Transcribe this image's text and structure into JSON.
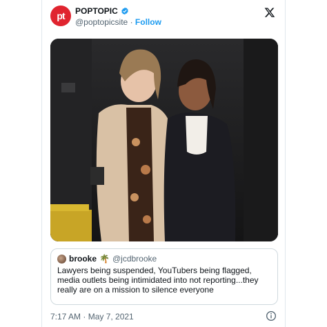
{
  "account": {
    "avatar_text": "pt",
    "name": "POPTOPIC",
    "handle": "@poptopicsite",
    "separator": "·",
    "follow_label": "Follow",
    "brand_color": "#e0242f",
    "accent_color": "#1d9bf0"
  },
  "icons": {
    "verified": "verified-badge-icon",
    "platform": "x-logo-icon",
    "info": "info-icon"
  },
  "quoted_tweet": {
    "name": "brooke",
    "emoji": "🌴",
    "handle": "@jcdbrooke",
    "text": "Lawyers being suspended, YouTubers being flagged, media outlets being intimidated into not reporting...they really are on a mission to silence everyone"
  },
  "footer": {
    "timestamp": "7:17 AM · May 7, 2021"
  }
}
